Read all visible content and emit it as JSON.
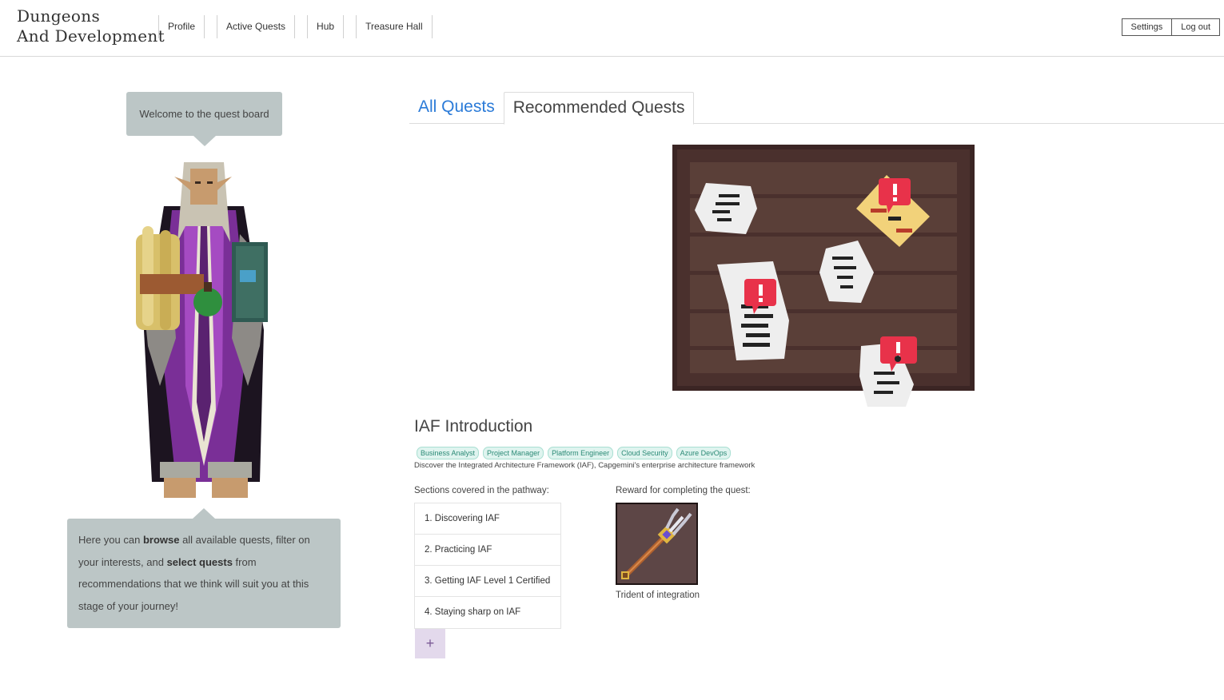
{
  "app": {
    "logo_line1": "Dungeons",
    "logo_line2": "And Development"
  },
  "nav": {
    "items": [
      {
        "label": "Profile"
      },
      {
        "label": "Active Quests"
      },
      {
        "label": "Hub"
      },
      {
        "label": "Treasure Hall"
      }
    ]
  },
  "header": {
    "settings_label": "Settings",
    "logout_label": "Log out"
  },
  "guide": {
    "welcome": "Welcome to the quest board",
    "intro_part1": "Here you can ",
    "intro_bold1": "browse",
    "intro_part2": " all available quests, filter on your interests, and ",
    "intro_bold2": "select quests",
    "intro_part3": " from recommendations that we think will suit you at this stage of your journey!"
  },
  "tabs": [
    {
      "label": "All Quests",
      "active": false
    },
    {
      "label": "Recommended Quests",
      "active": true
    }
  ],
  "quest": {
    "title": "IAF Introduction",
    "tags": [
      "Business Analyst",
      "Project Manager",
      "Platform Engineer",
      "Cloud Security",
      "Azure DevOps"
    ],
    "description": "Discover the Integrated Architecture Framework (IAF), Capgemini's enterprise architecture framework",
    "sections_label": "Sections covered in the pathway:",
    "sections": [
      "1. Discovering IAF",
      "2. Practicing IAF",
      "3. Getting IAF Level 1 Certified",
      "4. Staying sharp on IAF"
    ],
    "add_label": "+",
    "reward_label": "Reward for completing the quest:",
    "reward_name": "Trident of integration"
  },
  "colors": {
    "accent_blue": "#2b7bd8",
    "bubble": "#bcc6c6",
    "tag_bg": "#dff4ef",
    "tag_text": "#2b8a76",
    "board_wood": "#5a3f38",
    "alert_red": "#e8324a"
  }
}
